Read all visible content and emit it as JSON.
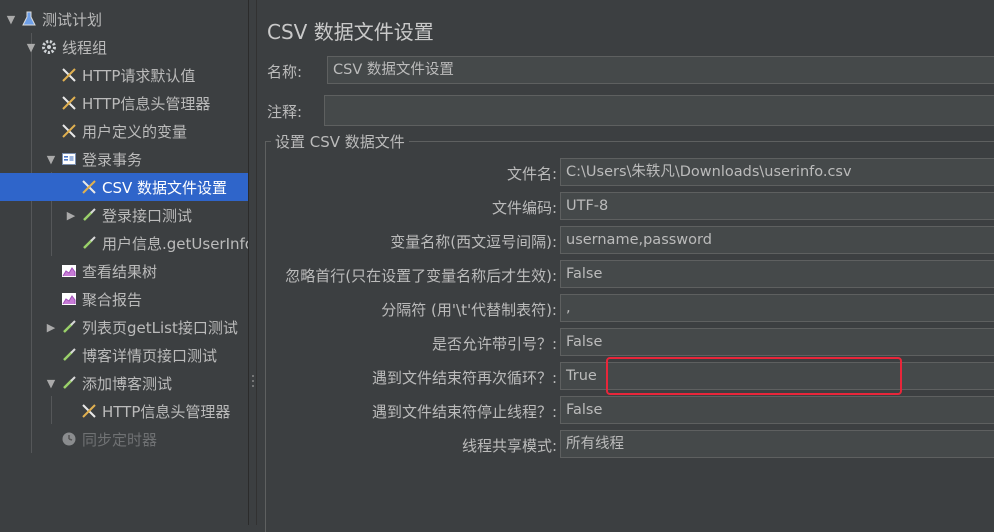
{
  "tree": {
    "items": [
      {
        "label": "测试计划",
        "icon": "flask-icon",
        "level": 0,
        "expanded": true
      },
      {
        "label": "线程组",
        "icon": "gear-icon",
        "level": 1,
        "expanded": true
      },
      {
        "label": "HTTP请求默认值",
        "icon": "wrench-icon",
        "level": 2
      },
      {
        "label": "HTTP信息头管理器",
        "icon": "wrench-icon",
        "level": 2
      },
      {
        "label": "用户定义的变量",
        "icon": "wrench-icon",
        "level": 2
      },
      {
        "label": "登录事务",
        "icon": "transaction-icon",
        "level": 2,
        "expanded": true
      },
      {
        "label": "CSV 数据文件设置",
        "icon": "wrench-icon",
        "level": 3,
        "selected": true
      },
      {
        "label": "登录接口测试",
        "icon": "pipette-icon",
        "level": 3,
        "expanded": false
      },
      {
        "label": "用户信息.getUserInfo",
        "icon": "pipette-icon",
        "level": 3
      },
      {
        "label": "查看结果树",
        "icon": "chart-icon",
        "level": 2
      },
      {
        "label": "聚合报告",
        "icon": "chart-icon",
        "level": 2
      },
      {
        "label": "列表页getList接口测试",
        "icon": "pipette-icon",
        "level": 2,
        "expanded": false
      },
      {
        "label": "博客详情页接口测试",
        "icon": "pipette-icon",
        "level": 2
      },
      {
        "label": "添加博客测试",
        "icon": "pipette-icon",
        "level": 2,
        "expanded": true
      },
      {
        "label": "HTTP信息头管理器",
        "icon": "wrench-icon",
        "level": 3
      },
      {
        "label": "同步定时器",
        "icon": "timer-icon",
        "level": 2,
        "disabled": true
      }
    ]
  },
  "panel": {
    "title": "CSV 数据文件设置",
    "name_label": "名称:",
    "name_value": "CSV 数据文件设置",
    "comment_label": "注释:",
    "comment_value": "",
    "group_title": "设置 CSV 数据文件",
    "rows": [
      {
        "label": "文件名:",
        "value": "C:\\Users\\朱轶凡\\Downloads\\userinfo.csv"
      },
      {
        "label": "文件编码:",
        "value": "UTF-8"
      },
      {
        "label": "变量名称(西文逗号间隔):",
        "value": "username,password"
      },
      {
        "label": "忽略首行(只在设置了变量名称后才生效):",
        "value": "False"
      },
      {
        "label": "分隔符 (用'\\t'代替制表符):",
        "value": ","
      },
      {
        "label": "是否允许带引号？:",
        "value": "False"
      },
      {
        "label": "遇到文件结束符再次循环？:",
        "value": "True"
      },
      {
        "label": "遇到文件结束符停止线程？:",
        "value": "False"
      },
      {
        "label": "线程共享模式:",
        "value": "所有线程"
      }
    ]
  },
  "colors": {
    "background": "#3c3f41",
    "selection": "#2f65ca",
    "field_bg": "#45494a",
    "highlight_border": "#e8263a"
  }
}
